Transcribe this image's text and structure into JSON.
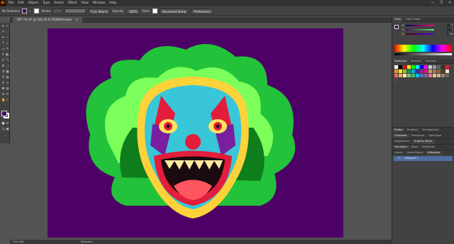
{
  "app": {
    "logo": "Ai",
    "window_controls": [
      "—",
      "❐",
      "✕"
    ]
  },
  "menu": [
    "File",
    "Edit",
    "Object",
    "Type",
    "Select",
    "Effect",
    "View",
    "Window",
    "Help"
  ],
  "control_bar": {
    "selection": "No Selection",
    "stroke_label": "Stroke:",
    "brush": "5 pt. Round",
    "opacity_label": "Opacity:",
    "opacity_value": "100%",
    "style_label": "Style:",
    "document_setup": "Document Setup",
    "preferences": "Preferences",
    "fill_color": "#4b0068"
  },
  "document_tab": {
    "title": "WIT Art.ai* @ 104.16 % (RGB/Preview)",
    "close": "×"
  },
  "artboard": {
    "background": "#4d0065"
  },
  "color_panel": {
    "tabs": [
      "Color",
      "Color Guide"
    ],
    "channels": [
      {
        "label": "R",
        "value": "75"
      },
      {
        "label": "G",
        "value": "0"
      },
      {
        "label": "B",
        "value": "104"
      }
    ],
    "hex": "4B0068"
  },
  "swatches_panel": {
    "tabs": [
      "Swatches",
      "Brushes",
      "Symbols"
    ],
    "colors": [
      "#ffffff",
      "#000000",
      "#ff0000",
      "#ffff00",
      "#00ff00",
      "#00ffff",
      "#0000ff",
      "#ff00ff",
      "#c8c8c8",
      "#969696",
      "#646464",
      "#323232",
      "#ed1c24",
      "#f7941d",
      "#fff200",
      "#8dc63f",
      "#00a651",
      "#00aeef",
      "#2e3192",
      "#92278f",
      "#ec008c",
      "#c69c6d",
      "#a67c52",
      "#8c6239",
      "#603913",
      "#e6e6e6",
      "#f26c4f",
      "#fbaf5d",
      "#fff799",
      "#7cc576",
      "#3bb878",
      "#00bff3",
      "#5674b9",
      "#855fa8",
      "#f06ea9",
      "#ffbd80",
      "#c7b299",
      "#998675",
      "#736357",
      "#534741"
    ]
  },
  "stacked_panels": [
    {
      "tabs": [
        "Stroke",
        "Gradient",
        "Transparency"
      ]
    },
    {
      "tabs": [
        "Character",
        "Paragraph",
        "OpenType"
      ]
    },
    {
      "tabs": [
        "Appearance",
        "Graphic Styles"
      ]
    },
    {
      "tabs": [
        "Transform",
        "Align",
        "Pathfinder"
      ]
    },
    {
      "tabs": [
        "Layers",
        "Asset Export",
        "Artboards"
      ]
    }
  ],
  "artboards_list": [
    {
      "index": "1",
      "name": "Artboard 1"
    }
  ],
  "status": {
    "zoom": "104.16%",
    "tool": "Selection"
  }
}
